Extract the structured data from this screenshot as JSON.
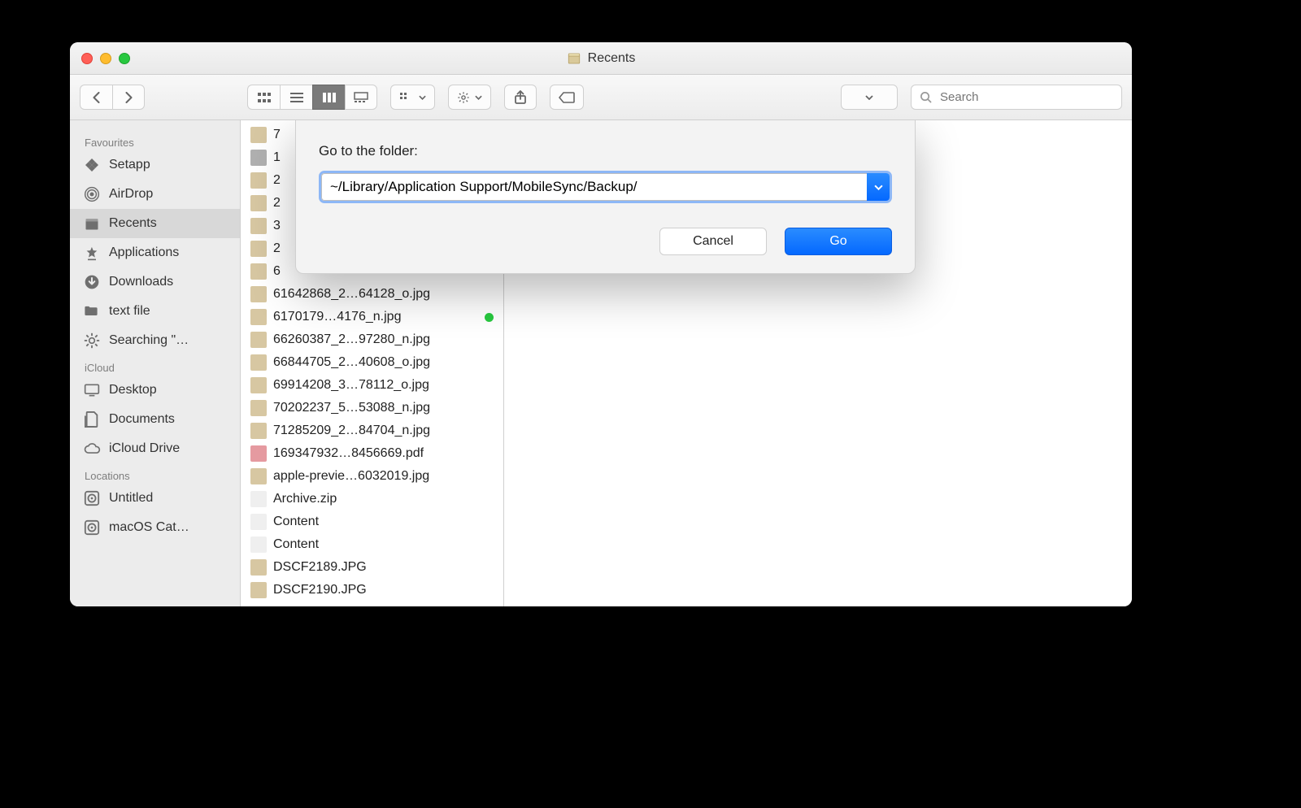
{
  "window": {
    "title": "Recents"
  },
  "toolbar": {
    "search_placeholder": "Search"
  },
  "sidebar": {
    "sections": [
      {
        "heading": "Favourites",
        "items": [
          {
            "icon": "grid",
            "label": "Setapp"
          },
          {
            "icon": "airdrop",
            "label": "AirDrop"
          },
          {
            "icon": "recents",
            "label": "Recents",
            "selected": true
          },
          {
            "icon": "apps",
            "label": "Applications"
          },
          {
            "icon": "downloads",
            "label": "Downloads"
          },
          {
            "icon": "folder",
            "label": "text file"
          },
          {
            "icon": "gear",
            "label": "Searching \"…"
          }
        ]
      },
      {
        "heading": "iCloud",
        "items": [
          {
            "icon": "desktop",
            "label": "Desktop"
          },
          {
            "icon": "documents",
            "label": "Documents"
          },
          {
            "icon": "cloud",
            "label": "iCloud Drive"
          }
        ]
      },
      {
        "heading": "Locations",
        "items": [
          {
            "icon": "disk",
            "label": "Untitled"
          },
          {
            "icon": "disk",
            "label": "macOS Cat…"
          }
        ]
      }
    ]
  },
  "files": [
    {
      "thumb": "img",
      "name": "7"
    },
    {
      "thumb": "cube",
      "name": "1"
    },
    {
      "thumb": "img",
      "name": "2"
    },
    {
      "thumb": "img",
      "name": "2"
    },
    {
      "thumb": "img",
      "name": "3"
    },
    {
      "thumb": "img",
      "name": "2"
    },
    {
      "thumb": "img",
      "name": "6"
    },
    {
      "thumb": "img",
      "name": "61642868_2…64128_o.jpg"
    },
    {
      "thumb": "img",
      "name": "6170179…4176_n.jpg",
      "tag": "#27c93f"
    },
    {
      "thumb": "img",
      "name": "66260387_2…97280_n.jpg"
    },
    {
      "thumb": "img",
      "name": "66844705_2…40608_o.jpg"
    },
    {
      "thumb": "img",
      "name": "69914208_3…78112_o.jpg"
    },
    {
      "thumb": "img",
      "name": "70202237_5…53088_n.jpg"
    },
    {
      "thumb": "img",
      "name": "71285209_2…84704_n.jpg"
    },
    {
      "thumb": "pdf",
      "name": "169347932…8456669.pdf"
    },
    {
      "thumb": "img",
      "name": "apple-previe…6032019.jpg"
    },
    {
      "thumb": "zip",
      "name": "Archive.zip"
    },
    {
      "thumb": "txt",
      "name": "Content"
    },
    {
      "thumb": "txt",
      "name": "Content"
    },
    {
      "thumb": "img",
      "name": "DSCF2189.JPG"
    },
    {
      "thumb": "img",
      "name": "DSCF2190.JPG"
    }
  ],
  "dialog": {
    "label": "Go to the folder:",
    "value": "~/Library/Application Support/MobileSync/Backup/",
    "cancel": "Cancel",
    "go": "Go"
  }
}
